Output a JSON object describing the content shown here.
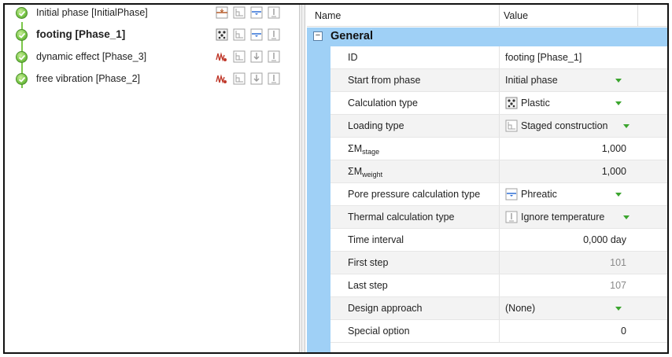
{
  "phases": [
    {
      "label": "Initial phase [InitialPhase]",
      "bold": false,
      "calc_icon": "gravity-loading-icon",
      "loading_icon": "staged-construction-icon",
      "pore_icon": "phreatic-icon",
      "thermal_icon": "ignore-temperature-icon"
    },
    {
      "label": "footing [Phase_1]",
      "bold": true,
      "calc_icon": "plastic-icon",
      "loading_icon": "staged-construction-icon",
      "pore_icon": "phreatic-icon",
      "thermal_icon": "ignore-temperature-icon"
    },
    {
      "label": "dynamic effect [Phase_3]",
      "bold": false,
      "calc_icon": "dynamic-icon",
      "loading_icon": "staged-construction-icon",
      "pore_icon": "use-previous-icon",
      "thermal_icon": "ignore-temperature-icon"
    },
    {
      "label": "free vibration [Phase_2]",
      "bold": false,
      "calc_icon": "dynamic-icon",
      "loading_icon": "staged-construction-icon",
      "pore_icon": "use-previous-icon",
      "thermal_icon": "ignore-temperature-icon"
    }
  ],
  "grid": {
    "header_name": "Name",
    "header_value": "Value",
    "group_toggle": "−",
    "group_label": "General",
    "rows": [
      {
        "name": "ID",
        "value": "footing [Phase_1]"
      },
      {
        "name": "Start from phase",
        "value": "Initial phase"
      },
      {
        "name": "Calculation type",
        "value": "Plastic",
        "icon": "plastic-icon"
      },
      {
        "name": "Loading type",
        "value": "Staged construction",
        "icon": "staged-construction-icon"
      },
      {
        "name_main": "ΣM",
        "name_sub": "stage",
        "value": "1,000"
      },
      {
        "name_main": "ΣM",
        "name_sub": "weight",
        "value": "1,000"
      },
      {
        "name": "Pore pressure calculation type",
        "value": "Phreatic",
        "icon": "phreatic-icon"
      },
      {
        "name": "Thermal calculation type",
        "value": "Ignore temperature",
        "icon": "ignore-temperature-icon"
      },
      {
        "name": "Time interval",
        "value": "0,000 day"
      },
      {
        "name": "First step",
        "value": "101"
      },
      {
        "name": "Last step",
        "value": "107"
      },
      {
        "name": "Design approach",
        "value": "(None)"
      },
      {
        "name": "Special option",
        "value": "0"
      }
    ]
  },
  "colors": {
    "group_band": "#9fd0f6",
    "status_green": "#7cc84a",
    "dropdown_arrow": "#3ba52e",
    "readonly_text": "#8a8a8a"
  }
}
